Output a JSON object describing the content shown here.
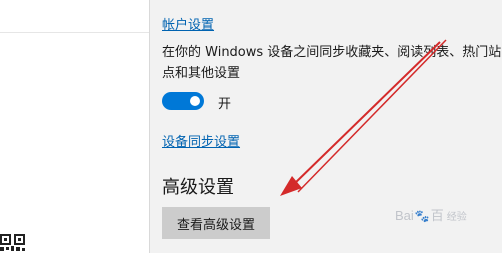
{
  "settings": {
    "account_link": "帐户设置",
    "sync_description": "在你的 Windows 设备之间同步收藏夹、阅读列表、热门站点和其他设置",
    "sync_toggle": {
      "state": "on",
      "label": "开"
    },
    "device_sync_link": "设备同步设置",
    "advanced_heading": "高级设置",
    "advanced_button": "查看高级设置"
  },
  "overlay": {
    "arrow_color": "#d42a2a",
    "watermark": {
      "brand_a": "Bai",
      "paw": "🐾",
      "brand_b": "百",
      "sub": "经验"
    }
  },
  "colors": {
    "accent": "#0078d7",
    "link": "#0063b1",
    "pane": "#f2f2f2"
  }
}
